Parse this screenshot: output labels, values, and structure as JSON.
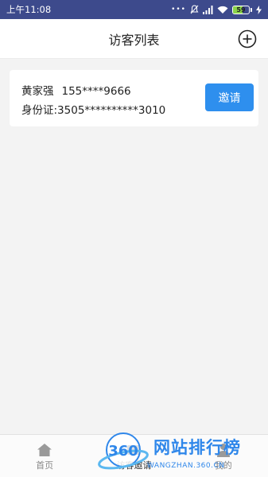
{
  "status_bar": {
    "time": "上午11:08",
    "battery_level": "59",
    "battery_fraction": 0.59,
    "battery_fill_color": "#8bd34a",
    "icons": [
      "dots-icon",
      "mute-icon",
      "signal-icon",
      "wifi-icon",
      "battery-icon",
      "charging-icon"
    ]
  },
  "header": {
    "title": "访客列表",
    "add_icon": "plus-circle-icon"
  },
  "visitor": {
    "name": "黄家强",
    "phone": "155****9666",
    "id_card": "身份证:3505**********3010",
    "invite_label": "邀请"
  },
  "bottom_nav": {
    "items": [
      {
        "label": "首页",
        "icon": "home-icon"
      },
      {
        "label": "访客邀请",
        "icon": "invite-icon"
      },
      {
        "label": "我的",
        "icon": "user-icon"
      }
    ]
  },
  "watermark": {
    "logo_text": "360",
    "title": "网站排行榜",
    "url": "WANGZHAN.360.CN"
  },
  "colors": {
    "status_bar_bg": "#3d4a8c",
    "accent": "#2e8fee",
    "page_bg": "#f3f3f3"
  }
}
